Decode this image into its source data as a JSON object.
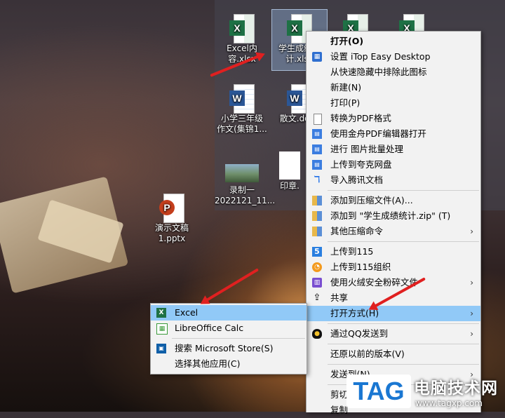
{
  "desktop": {
    "icons": [
      {
        "label": "Excel内容.xlsx",
        "type": "excel",
        "selected": false
      },
      {
        "label": "学生成绩统\n计.xlsx",
        "type": "excel",
        "selected": true
      },
      {
        "label": "",
        "type": "excel",
        "selected": false
      },
      {
        "label": "",
        "type": "excel",
        "selected": false
      },
      {
        "label": "小学三年级\n作文(集锦1...",
        "type": "word",
        "selected": false
      },
      {
        "label": "散文.docx",
        "type": "word",
        "selected": false
      },
      {
        "label": "录制一\n2022121_11...",
        "type": "video",
        "selected": false
      },
      {
        "label": "印章.",
        "type": "doc",
        "selected": false
      },
      {
        "label": "演示文稿\n1.pptx",
        "type": "ppt",
        "selected": false
      }
    ]
  },
  "context_menu": {
    "items": [
      {
        "label": "打开(O)",
        "icon": "",
        "bold": true
      },
      {
        "label": "设置 iTop Easy Desktop",
        "icon": "itop-grid-icon"
      },
      {
        "label": "从快速隐藏中排除此图标",
        "icon": ""
      },
      {
        "label": "新建(N)",
        "icon": ""
      },
      {
        "label": "打印(P)",
        "icon": ""
      },
      {
        "label": "转换为PDF格式",
        "icon": "document-icon"
      },
      {
        "label": "使用金舟PDF编辑器打开",
        "icon": "pdf-editor-icon"
      },
      {
        "label": "进行 图片批量处理",
        "icon": "image-batch-icon"
      },
      {
        "label": "上传到夸克网盘",
        "icon": "cloud-upload-icon"
      },
      {
        "label": "导入腾讯文档",
        "icon": "tencent-docs-icon"
      },
      {
        "label": "添加到压缩文件(A)...",
        "icon": "archive-icon"
      },
      {
        "label": "添加到 \"学生成绩统计.zip\" (T)",
        "icon": "archive-icon"
      },
      {
        "label": "其他压缩命令",
        "icon": "archive-icon",
        "submenu": true
      },
      {
        "label": "上传到115",
        "icon": "upload-115-icon"
      },
      {
        "label": "上传到115组织",
        "icon": "upload-115-org-icon"
      },
      {
        "label": "使用火绒安全粉碎文件",
        "icon": "shredder-icon",
        "submenu": true
      },
      {
        "label": "共享",
        "icon": "share-icon"
      },
      {
        "label": "打开方式(H)",
        "icon": "",
        "submenu": true,
        "highlighted": true
      },
      {
        "label": "通过QQ发送到",
        "icon": "qq-icon",
        "submenu": true
      },
      {
        "label": "还原以前的版本(V)",
        "icon": ""
      },
      {
        "label": "发送到(N)",
        "icon": "",
        "submenu": true
      },
      {
        "label": "剪切",
        "icon": ""
      },
      {
        "label": "复制",
        "icon": ""
      }
    ],
    "arrow": "›"
  },
  "open_with_menu": {
    "items": [
      {
        "label": "Excel",
        "icon": "excel-icon",
        "highlighted": true
      },
      {
        "label": "LibreOffice Calc",
        "icon": "libreoffice-calc-icon"
      },
      {
        "label": "搜索 Microsoft Store(S)",
        "icon": "microsoft-store-icon"
      },
      {
        "label": "选择其他应用(C)",
        "icon": ""
      }
    ]
  },
  "watermark": {
    "tag": "TAG",
    "title": "电脑技术网",
    "url": "www.tagxp.com"
  },
  "colors": {
    "highlight": "#91c9f7",
    "annotation_arrow": "#e02020",
    "watermark_blue": "#1a77d2"
  }
}
